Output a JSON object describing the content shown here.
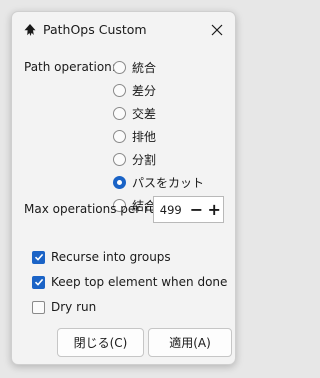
{
  "window": {
    "title": "PathOps Custom",
    "app_icon": "inkscape-logo-icon",
    "close_icon": "close-icon"
  },
  "operation": {
    "label": "Path operation:",
    "options": [
      {
        "label": "統合",
        "checked": false
      },
      {
        "label": "差分",
        "checked": false
      },
      {
        "label": "交差",
        "checked": false
      },
      {
        "label": "排他",
        "checked": false
      },
      {
        "label": "分割",
        "checked": false
      },
      {
        "label": "パスをカット",
        "checked": true
      },
      {
        "label": "結合",
        "checked": false
      }
    ]
  },
  "max_ops": {
    "label": "Max operations per run",
    "value": "499",
    "minus": "−",
    "plus": "+"
  },
  "checks": [
    {
      "label": "Recurse into groups",
      "checked": true
    },
    {
      "label": "Keep top element when done",
      "checked": true
    },
    {
      "label": "Dry run",
      "checked": false
    }
  ],
  "buttons": {
    "close": "閉じる(C)",
    "apply": "適用(A)"
  },
  "colors": {
    "accent": "#1a63c6"
  }
}
